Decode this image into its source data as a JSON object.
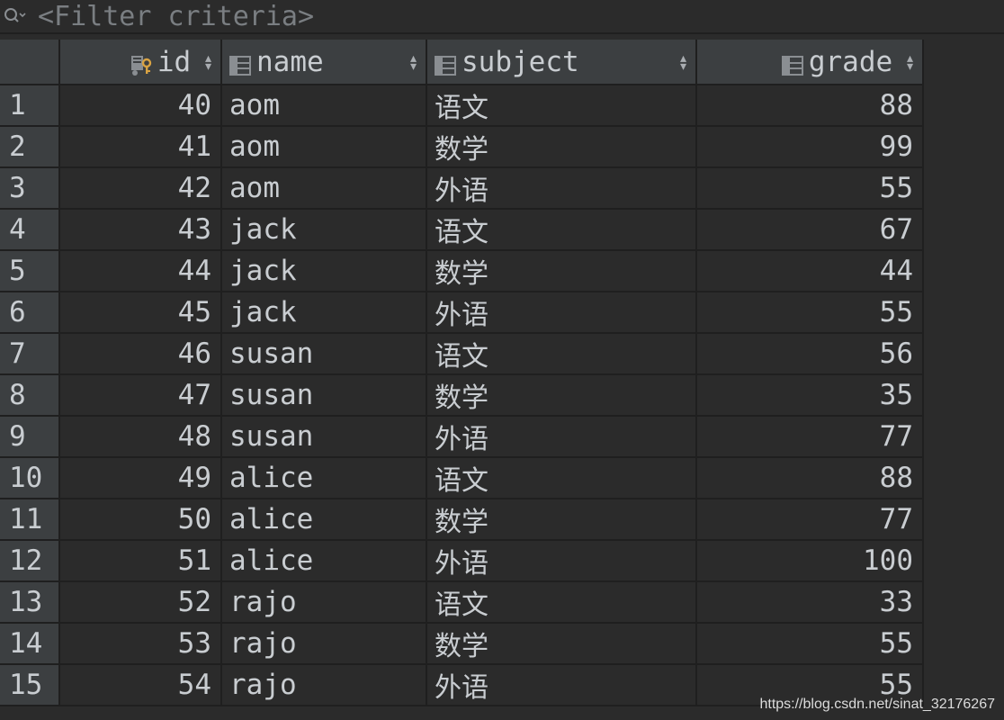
{
  "filter": {
    "placeholder": "<Filter criteria>",
    "icon": "search-icon"
  },
  "columns": [
    {
      "key": "id",
      "label": "id",
      "icon": "primary-key-column-icon"
    },
    {
      "key": "name",
      "label": "name",
      "icon": "table-column-icon"
    },
    {
      "key": "subject",
      "label": "subject",
      "icon": "table-column-icon"
    },
    {
      "key": "grade",
      "label": "grade",
      "icon": "table-column-icon"
    }
  ],
  "rows": [
    {
      "num": "1",
      "id": "40",
      "name": "aom",
      "subject": "语文",
      "grade": "88"
    },
    {
      "num": "2",
      "id": "41",
      "name": "aom",
      "subject": "数学",
      "grade": "99"
    },
    {
      "num": "3",
      "id": "42",
      "name": "aom",
      "subject": "外语",
      "grade": "55"
    },
    {
      "num": "4",
      "id": "43",
      "name": "jack",
      "subject": "语文",
      "grade": "67"
    },
    {
      "num": "5",
      "id": "44",
      "name": "jack",
      "subject": "数学",
      "grade": "44"
    },
    {
      "num": "6",
      "id": "45",
      "name": "jack",
      "subject": "外语",
      "grade": "55"
    },
    {
      "num": "7",
      "id": "46",
      "name": "susan",
      "subject": "语文",
      "grade": "56"
    },
    {
      "num": "8",
      "id": "47",
      "name": "susan",
      "subject": "数学",
      "grade": "35"
    },
    {
      "num": "9",
      "id": "48",
      "name": "susan",
      "subject": "外语",
      "grade": "77"
    },
    {
      "num": "10",
      "id": "49",
      "name": "alice",
      "subject": "语文",
      "grade": "88"
    },
    {
      "num": "11",
      "id": "50",
      "name": "alice",
      "subject": "数学",
      "grade": "77"
    },
    {
      "num": "12",
      "id": "51",
      "name": "alice",
      "subject": "外语",
      "grade": "100"
    },
    {
      "num": "13",
      "id": "52",
      "name": "rajo",
      "subject": "语文",
      "grade": "33"
    },
    {
      "num": "14",
      "id": "53",
      "name": "rajo",
      "subject": "数学",
      "grade": "55"
    },
    {
      "num": "15",
      "id": "54",
      "name": "rajo",
      "subject": "外语",
      "grade": "55"
    }
  ],
  "watermark": "https://blog.csdn.net/sinat_32176267",
  "colors": {
    "background": "#2b2b2b",
    "header": "#3c3f41",
    "text": "#c9cdd1",
    "key_accent": "#d9a343"
  }
}
